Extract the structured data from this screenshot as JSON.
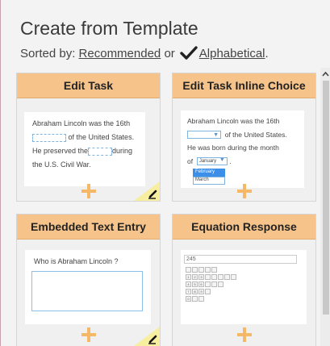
{
  "page": {
    "title": "Create from Template",
    "sort_prefix": "Sorted by:",
    "sort_option_recommended": "Recommended",
    "sort_or": "or",
    "sort_option_alphabetical": "Alphabetical",
    "sort_suffix": ".",
    "selected_sort": "Alphabetical"
  },
  "colors": {
    "header": "#f6c48b",
    "plus": "#f4b867",
    "edit_corner": "#f7eea0",
    "blank_border": "#7fb3e0"
  },
  "templates": [
    {
      "title": "Edit Task",
      "preview": {
        "line1": "Abraham Lincoln was the 16th",
        "line2_after": "of the United States.",
        "line3_before": "He preserved the",
        "line3_after": "during",
        "line4": "the U.S. Civil War."
      },
      "has_edit": true
    },
    {
      "title": "Edit Task Inline Choice",
      "preview": {
        "line1": "Abraham Lincoln was the 16th",
        "line2_after": "of the United States.",
        "line3": "He was born during the month",
        "line4_before": "of",
        "select_value": "January",
        "line4_after": ".",
        "options": [
          "February",
          "March"
        ]
      },
      "has_edit": false
    },
    {
      "title": "Embedded Text Entry",
      "preview": {
        "prompt": "Who is Abraham Lincoln ?"
      },
      "has_edit": true
    },
    {
      "title": "Equation Response",
      "preview": {
        "input_value": "245"
      },
      "has_edit": false
    }
  ]
}
